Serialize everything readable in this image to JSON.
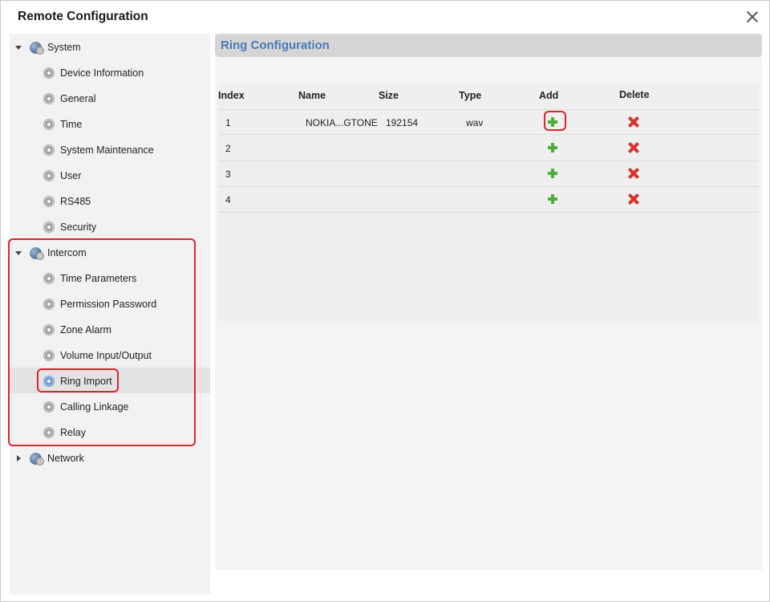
{
  "window": {
    "title": "Remote Configuration"
  },
  "sidebar": {
    "groups": [
      {
        "label": "System",
        "expanded": true,
        "items": [
          "Device Information",
          "General",
          "Time",
          "System Maintenance",
          "User",
          "RS485",
          "Security"
        ]
      },
      {
        "label": "Intercom",
        "expanded": true,
        "items": [
          "Time Parameters",
          "Permission Password",
          "Zone Alarm",
          "Volume Input/Output",
          "Ring Import",
          "Calling Linkage",
          "Relay"
        ]
      },
      {
        "label": "Network",
        "expanded": false,
        "items": []
      }
    ],
    "selected_item": "Ring Import"
  },
  "main": {
    "section_title": "Ring Configuration",
    "table": {
      "columns": [
        "Index",
        "Name",
        "Size",
        "Type",
        "Add",
        "Delete"
      ],
      "rows": [
        {
          "index": "1",
          "name": "NOKIA...GTONE",
          "size": "192154",
          "type": "wav"
        },
        {
          "index": "2",
          "name": "",
          "size": "",
          "type": ""
        },
        {
          "index": "3",
          "name": "",
          "size": "",
          "type": ""
        },
        {
          "index": "4",
          "name": "",
          "size": "",
          "type": ""
        }
      ]
    }
  },
  "icons": {
    "add": "plus-icon",
    "delete": "x-icon",
    "group": "globe-icon",
    "item": "gear-icon",
    "close": "close-icon"
  },
  "colors": {
    "section_title": "#4a7ab8",
    "add": "#4caf3a",
    "delete": "#d9322b",
    "highlight": "#e0242f"
  }
}
